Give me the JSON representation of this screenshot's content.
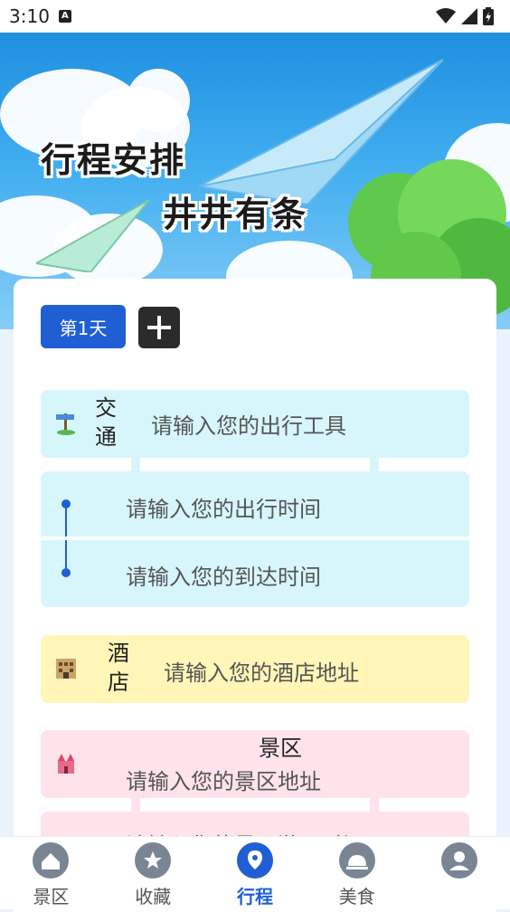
{
  "status_bar": {
    "time": "3:10"
  },
  "banner": {
    "line1": "行程安排",
    "line2": "井井有条"
  },
  "day_chip": "第1天",
  "transport": {
    "title": "交\n通",
    "tool_placeholder": "请输入您的出行工具",
    "depart_placeholder": "请输入您的出行时间",
    "arrive_placeholder": "请输入您的到达时间"
  },
  "hotel": {
    "title": "酒\n店",
    "placeholder": "请输入您的酒店地址"
  },
  "scenic": {
    "title": "景区",
    "placeholder": "请输入您的景区地址",
    "time_placeholder": "请输入您的景区游玩时间"
  },
  "nav": [
    {
      "label": "景区",
      "icon": "house-icon"
    },
    {
      "label": "收藏",
      "icon": "star-icon"
    },
    {
      "label": "行程",
      "icon": "location-pin-icon"
    },
    {
      "label": "美食",
      "icon": "food-dome-icon"
    },
    {
      "label": "",
      "icon": "user-icon"
    }
  ],
  "colors": {
    "accent": "#1f5fd3",
    "transport": "#d7f6fc",
    "hotel": "#fff6b8",
    "scenic": "#ffe3ea"
  }
}
